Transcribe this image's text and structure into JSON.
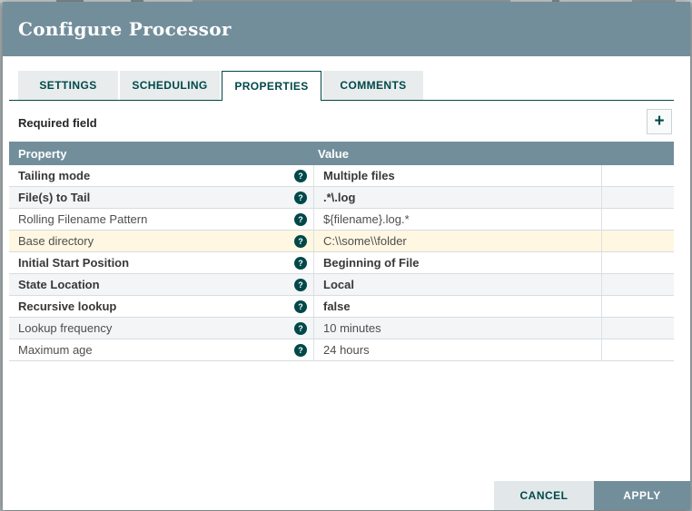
{
  "dialog": {
    "title": "Configure Processor",
    "tabs": [
      {
        "label": "SETTINGS",
        "active": false
      },
      {
        "label": "SCHEDULING",
        "active": false
      },
      {
        "label": "PROPERTIES",
        "active": true
      },
      {
        "label": "COMMENTS",
        "active": false
      }
    ],
    "required_field_label": "Required field",
    "icons": {
      "add": "+",
      "help": "?"
    },
    "table": {
      "columns": [
        "Property",
        "Value"
      ],
      "rows": [
        {
          "property": "Tailing mode",
          "value": "Multiple files",
          "bold": true,
          "highlight": false
        },
        {
          "property": "File(s) to Tail",
          "value": ".*\\.log",
          "bold": true,
          "highlight": false
        },
        {
          "property": "Rolling Filename Pattern",
          "value": "${filename}.log.*",
          "bold": false,
          "highlight": false
        },
        {
          "property": "Base directory",
          "value": "C:\\\\some\\\\folder",
          "bold": false,
          "highlight": true
        },
        {
          "property": "Initial Start Position",
          "value": "Beginning of File",
          "bold": true,
          "highlight": false
        },
        {
          "property": "State Location",
          "value": "Local",
          "bold": true,
          "highlight": false
        },
        {
          "property": "Recursive lookup",
          "value": "false",
          "bold": true,
          "highlight": false
        },
        {
          "property": "Lookup frequency",
          "value": "10 minutes",
          "bold": false,
          "highlight": false
        },
        {
          "property": "Maximum age",
          "value": "24 hours",
          "bold": false,
          "highlight": false
        }
      ]
    },
    "buttons": {
      "cancel": "CANCEL",
      "apply": "APPLY"
    },
    "colors": {
      "primary": "#728e9b",
      "accent_teal": "#004849",
      "highlight_row": "#fff7e1"
    }
  }
}
